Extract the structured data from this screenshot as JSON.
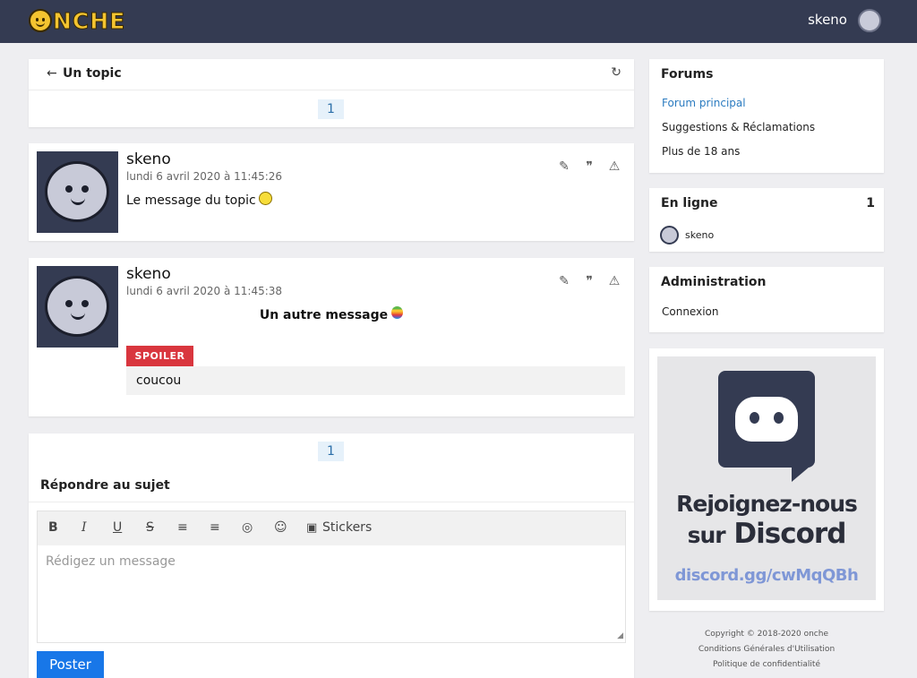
{
  "header": {
    "logo_text": "NCHE",
    "username": "skeno"
  },
  "topic": {
    "back_icon": "arrow-left-icon",
    "title": "Un topic",
    "refresh_icon": "refresh-icon",
    "page": "1"
  },
  "posts": [
    {
      "author": "skeno",
      "date": "lundi 6 avril 2020 à 11:45:26",
      "message": "Le message du topic"
    },
    {
      "author": "skeno",
      "date": "lundi 6 avril 2020 à 11:45:38",
      "message": "Un autre message",
      "spoiler_label": "SPOILER",
      "spoiler_content": "coucou"
    }
  ],
  "icons": {
    "edit": "✎",
    "quote": "❞",
    "report": "⚠"
  },
  "reply": {
    "page": "1",
    "title": "Répondre au sujet",
    "toolbar": {
      "bold": "B",
      "italic": "I",
      "underline": "U",
      "strike": "S",
      "center": "≡",
      "right": "≡",
      "spoiler": "◎",
      "emoji": "☺",
      "stickers_icon": "▣",
      "stickers": "Stickers"
    },
    "placeholder": "Rédigez un message",
    "submit": "Poster"
  },
  "sidebar": {
    "forums_title": "Forums",
    "forums": [
      {
        "label": "Forum principal",
        "active": true
      },
      {
        "label": "Suggestions & Réclamations",
        "active": false
      },
      {
        "label": "Plus de 18 ans",
        "active": false
      }
    ],
    "online_title": "En ligne",
    "online_count": "1",
    "online_user": "skeno",
    "admin_title": "Administration",
    "admin_link": "Connexion",
    "discord": {
      "line1": "Rejoignez-nous",
      "line2_prefix": "sur",
      "line2_brand": "Discord",
      "link": "discord.gg/cwMqQBh"
    }
  },
  "footer": {
    "copyright": "Copyright © 2018-2020 onche",
    "terms": "Conditions Générales d'Utilisation",
    "privacy": "Politique de confidentialité"
  },
  "colors": {
    "header_bg": "#343b52",
    "accent_blue": "#1877e8",
    "link_blue": "#2b7bc0",
    "spoiler_red": "#d9363e",
    "logo_yellow": "#f4c430"
  }
}
